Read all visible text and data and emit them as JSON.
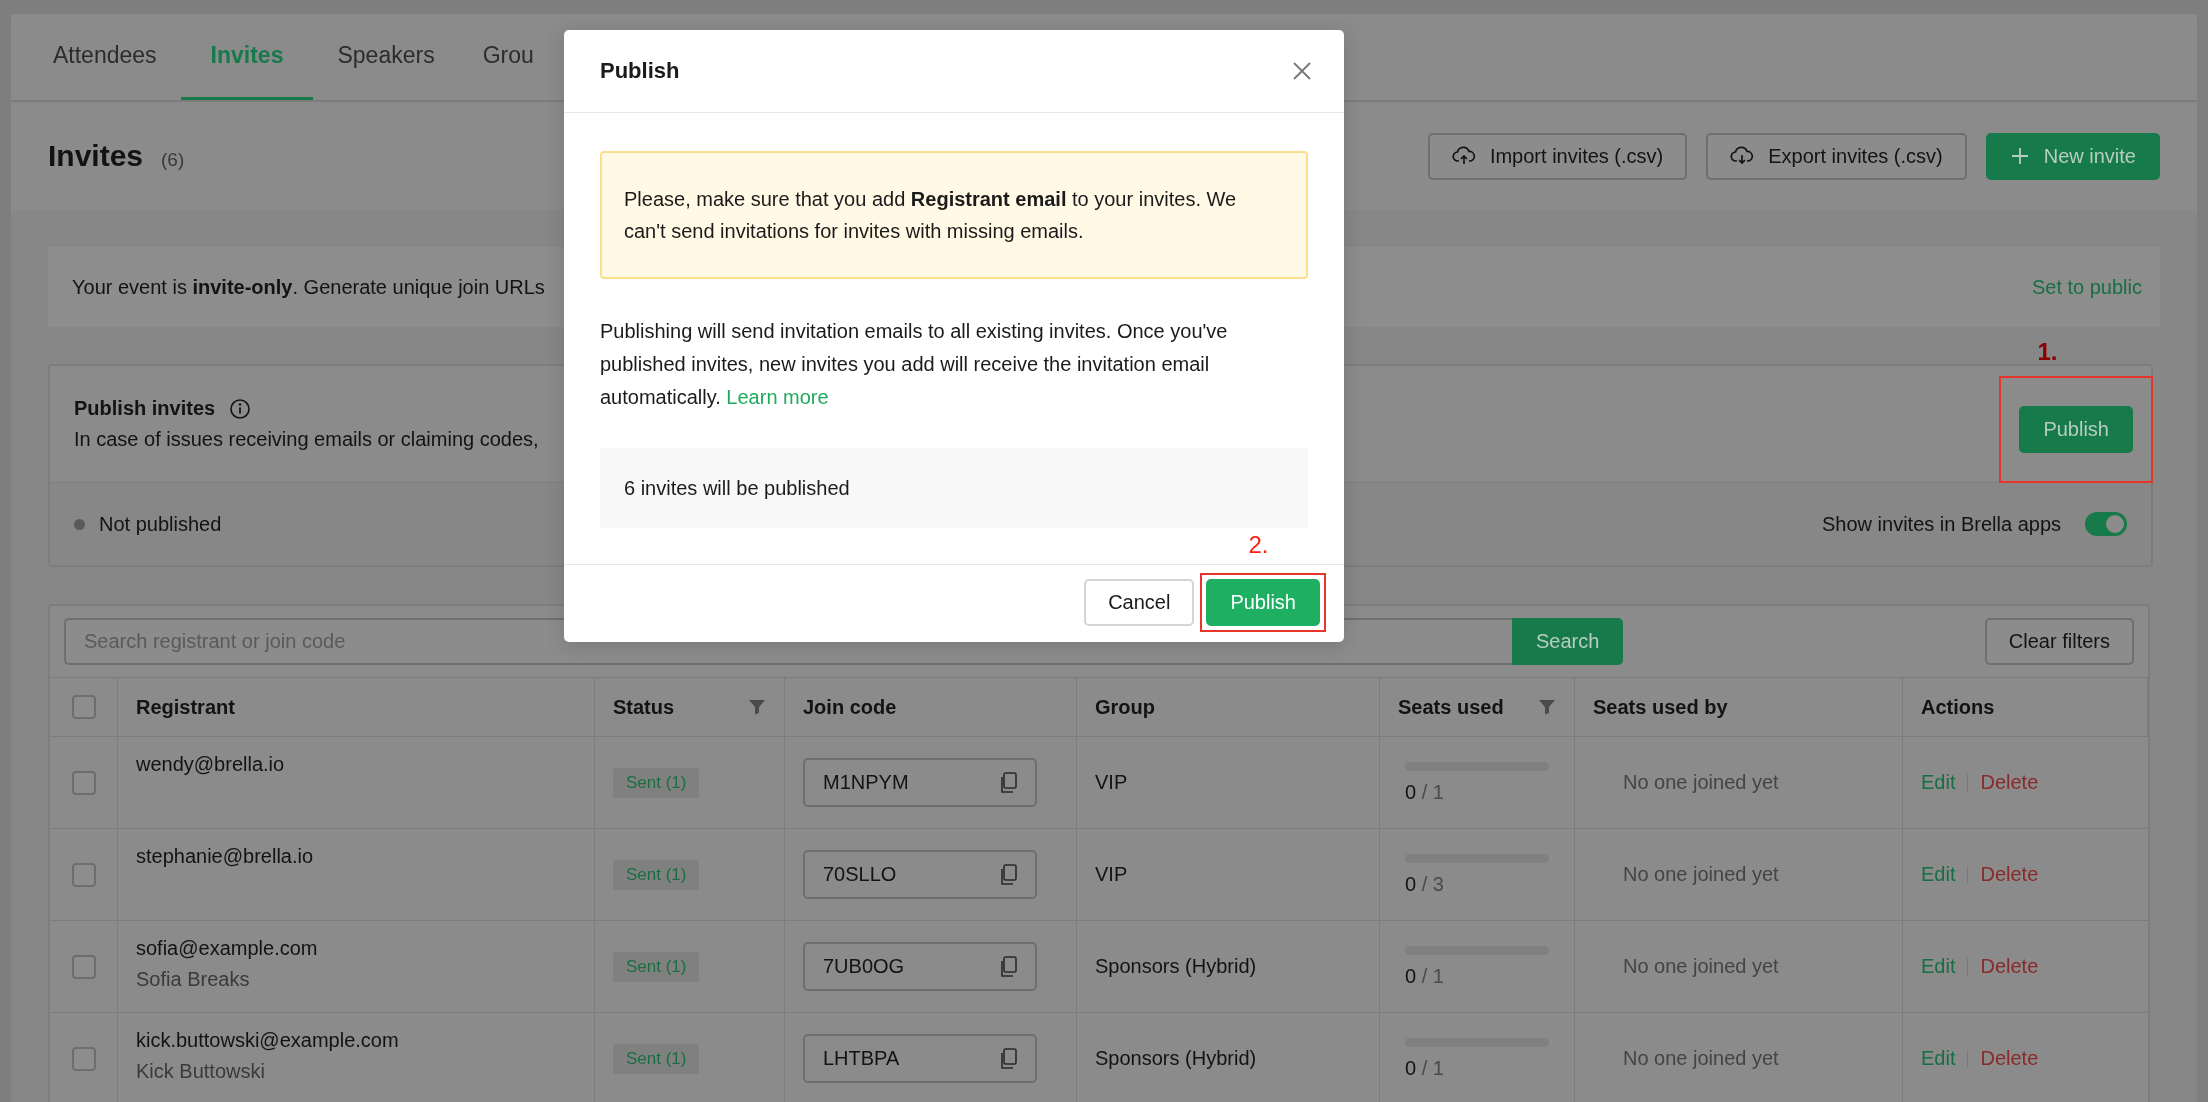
{
  "tabs": [
    {
      "label": "Attendees",
      "selected": false
    },
    {
      "label": "Invites",
      "selected": true
    },
    {
      "label": "Speakers",
      "selected": false
    },
    {
      "label": "Grou",
      "selected": false
    }
  ],
  "header": {
    "title": "Invites",
    "count": "(6)",
    "buttons": [
      {
        "label": "Import invites (.csv)",
        "kind": "upload"
      },
      {
        "label": "Export invites (.csv)",
        "kind": "download"
      },
      {
        "label": "New invite",
        "kind": "add"
      }
    ]
  },
  "notice": {
    "text": "Your event is **invite-only**. Generate unique join URLs",
    "link": "Set to public"
  },
  "publish_card": {
    "title": "Publish invites",
    "description": "In case of issues receiving emails or claiming codes,",
    "button": "Publish",
    "annotation": "1.",
    "status": "Not published",
    "toggle": {
      "label": "Show invites in Brella apps",
      "on": true
    }
  },
  "table": {
    "search": {
      "placeholder": "Search registrant or join code"
    },
    "search_button": "Search",
    "clear_button": "Clear filters",
    "header_checkbox": {
      "checked": false
    },
    "columns": [
      {
        "label": "Registrant",
        "filter": false
      },
      {
        "label": "Status",
        "filter": true
      },
      {
        "label": "Join code",
        "filter": false
      },
      {
        "label": "Group",
        "filter": false
      },
      {
        "label": "Seats used",
        "filter": true
      },
      {
        "label": "Seats used by",
        "filter": false
      },
      {
        "label": "Actions",
        "filter": false
      }
    ],
    "rows": [
      {
        "checked": false,
        "email": "wendy@brella.io",
        "status": "Sent (1)",
        "code": "M1NPYM",
        "group": "VIP",
        "level": 0,
        "seats_used": "0",
        "seats_total": "/ 1",
        "seats_used_by": "No one joined yet",
        "edit": "Edit",
        "delete": "Delete"
      },
      {
        "checked": false,
        "email": "stephanie@brella.io",
        "status": "Sent (1)",
        "code": "70SLLO",
        "group": "VIP",
        "level": 0,
        "seats_used": "0",
        "seats_total": "/ 3",
        "seats_used_by": "No one joined yet",
        "edit": "Edit",
        "delete": "Delete"
      },
      {
        "checked": false,
        "email": "sofia@example.com",
        "name": "Sofia Breaks",
        "status": "Sent (1)",
        "code": "7UB0OG",
        "group": "Sponsors (Hybrid)",
        "level": 0,
        "seats_used": "0",
        "seats_total": "/ 1",
        "seats_used_by": "No one joined yet",
        "edit": "Edit",
        "delete": "Delete"
      },
      {
        "checked": false,
        "email": "kick.buttowski@example.com",
        "name": "Kick Buttowski",
        "status": "Sent (1)",
        "code": "LHTBPA",
        "group": "Sponsors (Hybrid)",
        "level": 0,
        "seats_used": "0",
        "seats_total": "/ 1",
        "seats_used_by": "No one joined yet",
        "edit": "Edit",
        "delete": "Delete"
      }
    ]
  },
  "modal": {
    "title": "Publish",
    "warning": "Please, make sure that you add **Registrant email** to your invites. We can't send invitations for invites with missing emails.",
    "body": "Publishing will send invitation emails to all existing invites. Once you've published invites, new invites you add will receive the invitation email automatically.",
    "link": "Learn more",
    "count": "6 invites will be published",
    "cancel": "Cancel",
    "confirm": "Publish",
    "annotation": "2."
  }
}
